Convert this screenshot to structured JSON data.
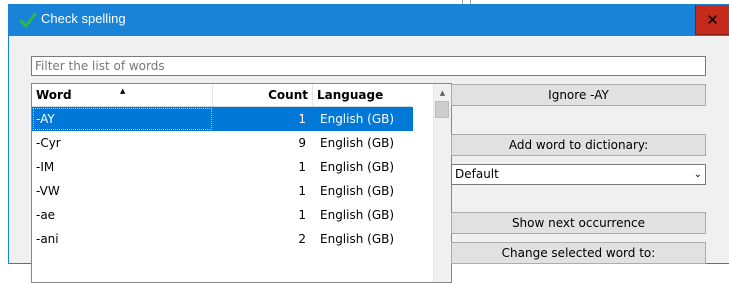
{
  "window": {
    "title": "Check spelling",
    "close_label": "✕"
  },
  "filter": {
    "placeholder": "Filter the list of words",
    "value": ""
  },
  "table": {
    "columns": [
      "Word",
      "Count",
      "Language"
    ],
    "sort_indicator": "▲",
    "rows": [
      {
        "word": "-AY",
        "count": "1",
        "language": "English (GB)",
        "selected": true
      },
      {
        "word": "-Cyr",
        "count": "9",
        "language": "English (GB)",
        "selected": false
      },
      {
        "word": "-IM",
        "count": "1",
        "language": "English (GB)",
        "selected": false
      },
      {
        "word": "-VW",
        "count": "1",
        "language": "English (GB)",
        "selected": false
      },
      {
        "word": "-ae",
        "count": "1",
        "language": "English (GB)",
        "selected": false
      },
      {
        "word": "-ani",
        "count": "2",
        "language": "English (GB)",
        "selected": false
      }
    ]
  },
  "actions": {
    "ignore_label": "Ignore -AY",
    "add_label": "Add word to dictionary:",
    "dictionary_selected": "Default",
    "show_next_label": "Show next occurrence",
    "change_label": "Change selected word to:"
  },
  "colors": {
    "titlebar": "#1883d7",
    "selection": "#0078d7",
    "close_button": "#c42b1c"
  },
  "icons": {
    "title_icon": "checkmark-icon",
    "close_icon": "close-icon",
    "scroll_up_icon": "scroll-up-icon",
    "dropdown_icon": "chevron-down-icon"
  }
}
